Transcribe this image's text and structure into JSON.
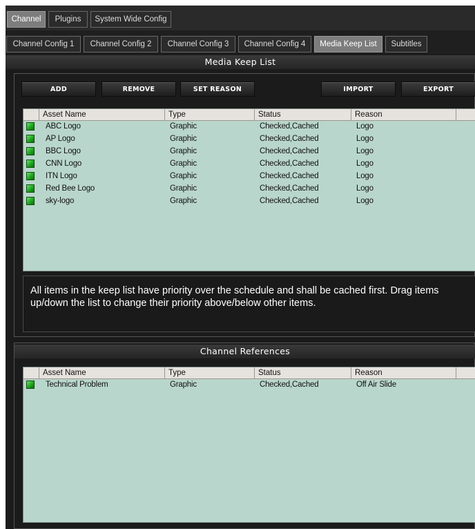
{
  "top_tabs": [
    "Channel",
    "Plugins",
    "System Wide Config"
  ],
  "sub_tabs": [
    "Channel Config 1",
    "Channel Config 2",
    "Channel Config 3",
    "Channel Config 4",
    "Media Keep List",
    "Subtitles"
  ],
  "active_top_tab": "Channel",
  "active_sub_tab": "Media Keep List",
  "keep_list": {
    "title": "Media Keep List",
    "buttons": {
      "add": "ADD",
      "remove": "REMOVE",
      "set_reason": "SET REASON",
      "import": "IMPORT",
      "export": "EXPORT"
    },
    "columns": [
      "Asset Name",
      "Type",
      "Status",
      "Reason"
    ],
    "rows": [
      {
        "name": "ABC Logo",
        "type": "Graphic",
        "status": "Checked,Cached",
        "reason": "Logo"
      },
      {
        "name": "AP Logo",
        "type": "Graphic",
        "status": "Checked,Cached",
        "reason": "Logo"
      },
      {
        "name": "BBC Logo",
        "type": "Graphic",
        "status": "Checked,Cached",
        "reason": "Logo"
      },
      {
        "name": "CNN Logo",
        "type": "Graphic",
        "status": "Checked,Cached",
        "reason": "Logo"
      },
      {
        "name": "ITN Logo",
        "type": "Graphic",
        "status": "Checked,Cached",
        "reason": "Logo"
      },
      {
        "name": "Red Bee Logo",
        "type": "Graphic",
        "status": "Checked,Cached",
        "reason": "Logo"
      },
      {
        "name": "sky-logo",
        "type": "Graphic",
        "status": "Checked,Cached",
        "reason": "Logo"
      }
    ],
    "info_text": "All items in the keep list have priority over the schedule and shall be cached first. Drag items up/down the list to change their priority above/below other items."
  },
  "channel_references": {
    "title": "Channel References",
    "columns": [
      "Asset Name",
      "Type",
      "Status",
      "Reason"
    ],
    "rows": [
      {
        "name": "Technical Problem",
        "type": "Graphic",
        "status": "Checked,Cached",
        "reason": "Off Air Slide"
      }
    ]
  },
  "colors": {
    "grid_bg": "#b9d6cc",
    "panel_bg": "#1b1b1b",
    "status_ok": "#1ea51e"
  }
}
